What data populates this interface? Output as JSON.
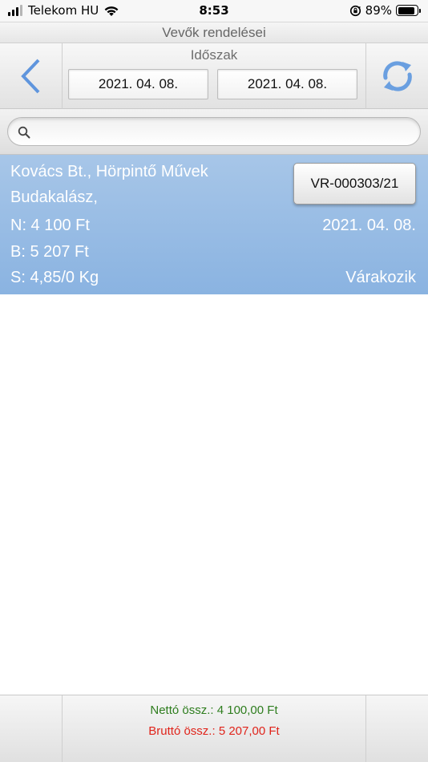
{
  "status_bar": {
    "carrier": "Telekom HU",
    "time": "8:53",
    "battery_percent": "89%",
    "battery_level": 0.89,
    "signal_bars": 3,
    "icons": [
      "signal-icon",
      "wifi-icon",
      "orientation-lock-icon",
      "battery-icon"
    ]
  },
  "header": {
    "title": "Vevők rendelései"
  },
  "toolbar": {
    "back_icon": "chevron-left-icon",
    "refresh_icon": "refresh-icon",
    "period_label": "Időszak",
    "date_from": "2021. 04. 08.",
    "date_to": "2021. 04. 08."
  },
  "search": {
    "placeholder": "",
    "value": "",
    "icon": "search-icon"
  },
  "orders": [
    {
      "customer": "Kovács Bt., Hörpintő Művek",
      "city": "Budakalász,",
      "net": "N: 4 100 Ft",
      "gross": "B: 5 207 Ft",
      "weight": "S: 4,85/0 Kg",
      "order_number": "VR-000303/21",
      "date": "2021. 04. 08.",
      "status": "Várakozik"
    }
  ],
  "footer": {
    "net_total": "Nettó össz.: 4 100,00 Ft",
    "gross_total": "Bruttó össz.: 5 207,00 Ft"
  },
  "colors": {
    "accent_blue": "#7fa8e0",
    "row_selected": "#9bbde5",
    "net_green": "#2e7d1e",
    "gross_red": "#e0241b"
  }
}
